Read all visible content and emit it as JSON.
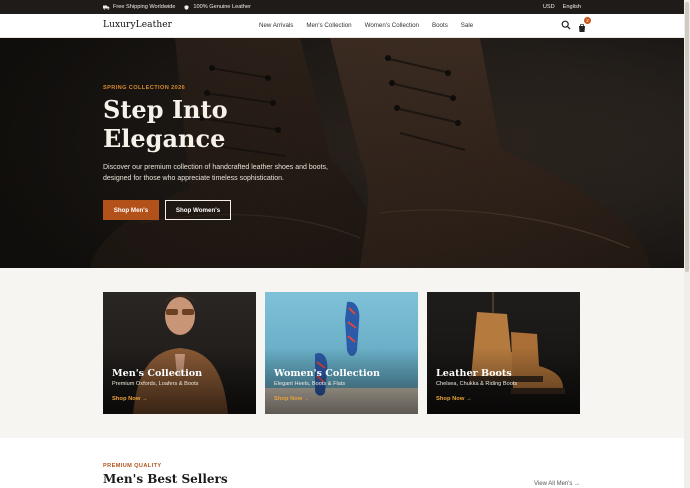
{
  "topbar": {
    "shipping": "Free Shipping Worldwide",
    "genuine": "100% Genuine Leather",
    "currency": "USD",
    "language": "English"
  },
  "header": {
    "logo": "LuxuryLeather",
    "nav": [
      "New Arrivals",
      "Men's Collection",
      "Women's Collection",
      "Boots",
      "Sale"
    ],
    "cart_count": "2"
  },
  "hero": {
    "eyebrow": "SPRING COLLECTION 2026",
    "title_line1": "Step Into",
    "title_line2": "Elegance",
    "description": "Discover our premium collection of handcrafted leather shoes and boots, designed for those who appreciate timeless sophistication.",
    "btn_primary": "Shop Men's",
    "btn_secondary": "Shop Women's"
  },
  "categories": [
    {
      "title": "Men's Collection",
      "subtitle": "Premium Oxfords, Loafers & Boots",
      "link": "Shop Now →"
    },
    {
      "title": "Women's Collection",
      "subtitle": "Elegant Heels, Boots & Flats",
      "link": "Shop Now →"
    },
    {
      "title": "Leather Boots",
      "subtitle": "Chelsea, Chukka & Riding Boots",
      "link": "Shop Now →"
    }
  ],
  "bestsellers": {
    "eyebrow": "PREMIUM QUALITY",
    "title": "Men's Best Sellers",
    "view_all": "View All Men's →"
  },
  "colors": {
    "accent": "#b3511a",
    "topbar_bg": "#1f1b18",
    "eyebrow": "#d98a2e"
  },
  "icons": [
    "truck-icon",
    "shield-icon",
    "search-icon",
    "cart-icon",
    "arrow-right-icon"
  ]
}
